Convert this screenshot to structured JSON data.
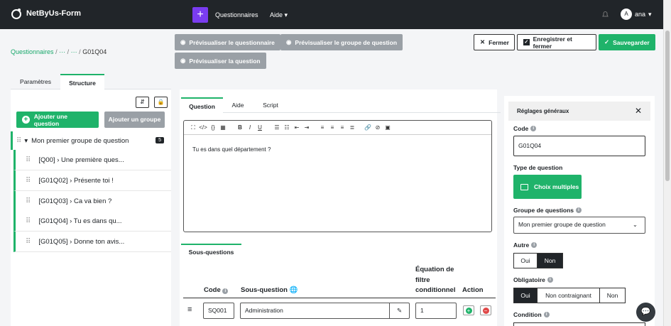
{
  "app": {
    "name": "NetByUs-Form",
    "menu_questionnaires": "Questionnaires",
    "menu_aide": "Aide",
    "user_initial": "A",
    "user_name": "ana"
  },
  "breadcrumb": {
    "root": "Questionnaires",
    "sep1": "/",
    "ell1": "···",
    "sep2": "/",
    "ell2": "···",
    "sep3": "/",
    "current": "G01Q04"
  },
  "toolbar": {
    "preview_questionnaire": "Prévisualiser le questionnaire",
    "preview_group": "Prévisualiser le groupe de question",
    "preview_question": "Prévisualiser la question",
    "close": "Fermer",
    "save_close": "Enregistrer et fermer",
    "save": "Sauvegarder"
  },
  "left": {
    "tabs": [
      "Paramètres",
      "Structure"
    ],
    "add_question": "Ajouter une question",
    "add_group": "Ajouter un groupe",
    "group": {
      "name": "Mon premier groupe de question",
      "count": "5"
    },
    "questions": [
      "[Q00] › Une première ques...",
      "[G01Q02] › Présente toi !",
      "[G01Q03] › Ca va bien ?",
      "[G01Q04] › Tu es dans qu...",
      "[G01Q05] › Donne ton avis..."
    ]
  },
  "editor": {
    "tabs": [
      "Question",
      "Aide",
      "Script"
    ],
    "content": "Tu es dans quel département ?"
  },
  "subq": {
    "tab": "Sous-questions",
    "col_code": "Code",
    "col_sub": "Sous-question",
    "col_eq_1": "Équation de",
    "col_eq_2": "filtre",
    "col_eq_3": "conditionnel",
    "col_action": "Action",
    "row_code": "SQ001",
    "row_text": "Administration",
    "row_eq": "1"
  },
  "settings": {
    "title": "Réglages généraux",
    "code_label": "Code",
    "code_value": "G01Q04",
    "type_label": "Type de question",
    "type_value": "Choix multiples",
    "group_label": "Groupe de questions",
    "group_value": "Mon premier groupe de question",
    "autre_label": "Autre",
    "oui": "Oui",
    "non": "Non",
    "oblig_label": "Obligatoire",
    "non_contraignant": "Non contraignant",
    "condition_label": "Condition"
  },
  "colors": {
    "accent": "#1fb36a",
    "brand_purple": "#7a3cf0",
    "dark": "#212529"
  }
}
